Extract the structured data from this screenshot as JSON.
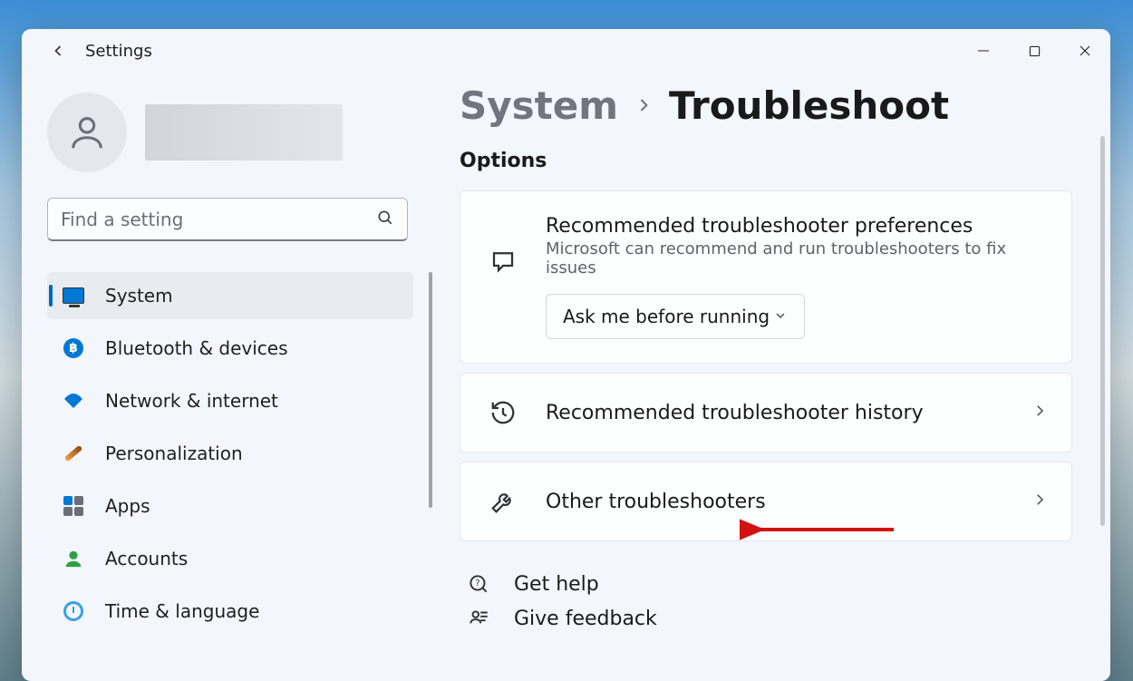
{
  "app_title": "Settings",
  "search": {
    "placeholder": "Find a setting"
  },
  "sidebar": {
    "items": [
      {
        "label": "System"
      },
      {
        "label": "Bluetooth & devices"
      },
      {
        "label": "Network & internet"
      },
      {
        "label": "Personalization"
      },
      {
        "label": "Apps"
      },
      {
        "label": "Accounts"
      },
      {
        "label": "Time & language"
      }
    ]
  },
  "breadcrumb": {
    "parent": "System",
    "current": "Troubleshoot"
  },
  "section_header": "Options",
  "prefs_card": {
    "title": "Recommended troubleshooter preferences",
    "subtitle": "Microsoft can recommend and run troubleshooters to fix issues",
    "select_value": "Ask me before running"
  },
  "history_card": {
    "title": "Recommended troubleshooter history"
  },
  "other_card": {
    "title": "Other troubleshooters"
  },
  "links": {
    "help": "Get help",
    "feedback": "Give feedback"
  }
}
